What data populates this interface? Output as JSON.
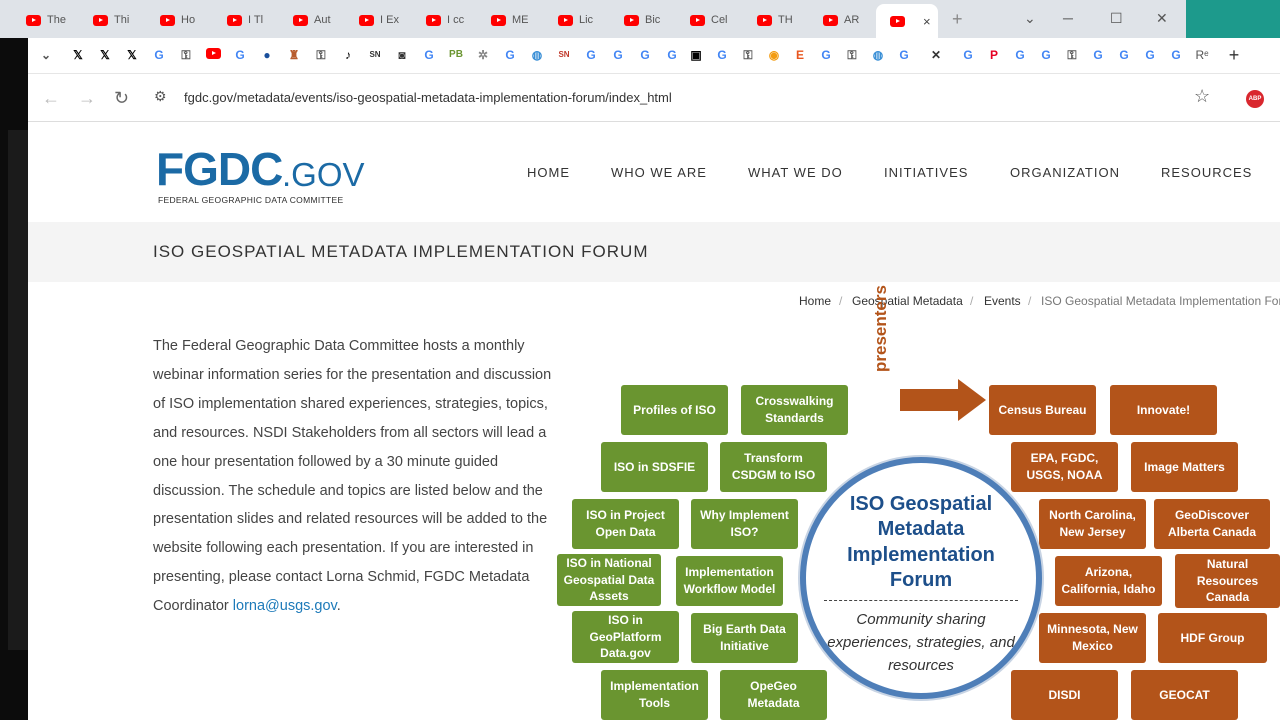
{
  "browser": {
    "tabs": [
      "The",
      "Thi",
      "Ho",
      "I Tl",
      "Aut",
      "I Ex",
      "I cc",
      "ME",
      "Lic",
      "Bic",
      "Cel",
      "TH",
      "AR"
    ],
    "new_tab_glyph": "+",
    "tab_close_glyph": "×",
    "window_controls": {
      "dropdown": "⌄",
      "minimize": "─",
      "maximize": "☐",
      "close": "✕"
    },
    "bookmark_icons": [
      "chevron-down",
      "x",
      "x",
      "x",
      "google",
      "puzzle",
      "youtube",
      "google",
      "noaa",
      "hat",
      "puzzle",
      "tiktok",
      "sn",
      "camera",
      "google",
      "pb",
      "flower",
      "google",
      "globe",
      "sn",
      "google",
      "google",
      "google",
      "pi",
      "google",
      "puzzle",
      "circle",
      "etsy",
      "google",
      "puzzle",
      "globe",
      "google",
      "close",
      "google",
      "pinterest",
      "google",
      "google",
      "puzzle",
      "google",
      "google",
      "google",
      "r"
    ],
    "bookmark_active_glyph": "✕",
    "back": "←",
    "forward": "→",
    "reload": "↻",
    "url": "fgdc.gov/metadata/events/iso-geospatial-metadata-implementation-forum/index_html",
    "star": "☆",
    "extension": "ABP"
  },
  "site": {
    "logo_main": "FGDC",
    "logo_suffix": ".GOV",
    "logo_sub": "FEDERAL GEOGRAPHIC DATA COMMITTEE",
    "nav": [
      "HOME",
      "WHO WE ARE",
      "WHAT WE DO",
      "INITIATIVES",
      "ORGANIZATION",
      "RESOURCES"
    ]
  },
  "page": {
    "title": "ISO GEOSPATIAL METADATA IMPLEMENTATION FORUM",
    "breadcrumb": [
      "Home",
      "Geospatial Metadata",
      "Events",
      "ISO Geospatial Metadata Implementation Forum"
    ],
    "breadcrumb_sep": "/",
    "body_text": "The Federal Geographic Data Committee hosts a monthly webinar information series for the presentation and discussion of ISO implementation shared experiences, strategies, topics, and resources. NSDI Stakeholders from all sectors will lead a one hour presentation followed by a 30 minute guided discussion. The schedule and topics are listed below and the presentation slides and related resources will be added to the website following each presentation. If you are interested in presenting, please contact Lorna Schmid, FGDC Metadata Coordinator",
    "contact_link": "lorna@usgs.gov",
    "after_link": "."
  },
  "graphic": {
    "center_title": "ISO Geospatial Metadata Implementation Forum",
    "center_sub": "Community sharing experiences, strategies, and resources",
    "presenters": "presenters",
    "green_topics": [
      "Profiles of ISO",
      "Crosswalking Standards",
      "ISO in SDSFIE",
      "Transform CSDGM to ISO",
      "ISO in Project Open Data",
      "Why Implement ISO?",
      "ISO in National Geospatial Data Assets",
      "Implementation Workflow Model",
      "ISO in GeoPlatform Data.gov",
      "Big Earth Data Initiative",
      "Implementation Tools",
      "OpeGeo Metadata"
    ],
    "orange_presenters": [
      "Census Bureau",
      "Innovate!",
      "EPA, FGDC, USGS, NOAA",
      "Image Matters",
      "North Carolina, New Jersey",
      "GeoDiscover Alberta Canada",
      "Arizona, California, Idaho",
      "Natural Resources Canada",
      "Minnesota, New Mexico",
      "HDF Group",
      "DISDI",
      "GEOCAT"
    ],
    "colors": {
      "green": "#6a9530",
      "orange": "#b3541a",
      "ring": "#4e7eb8",
      "title": "#1d4f8a"
    }
  }
}
